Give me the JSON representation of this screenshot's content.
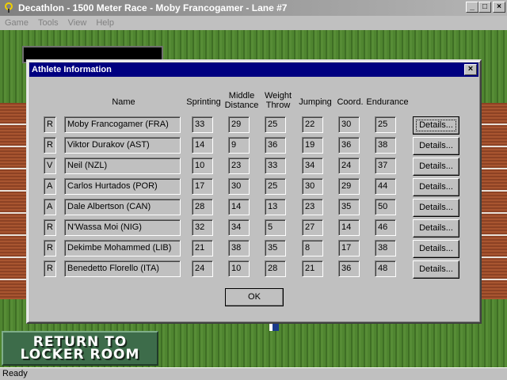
{
  "window": {
    "title": "Decathlon - 1500 Meter Race - Moby Francogamer - Lane #7",
    "icon": "decathlon-app-icon",
    "controls": [
      "minimize",
      "maximize",
      "close"
    ]
  },
  "menu": [
    "Game",
    "Tools",
    "View",
    "Help"
  ],
  "dialog": {
    "title": "Athlete Information",
    "headers": {
      "name": "Name",
      "sprinting": "Sprinting",
      "middle_distance": "Middle Distance",
      "weight_throw": "Weight Throw",
      "jumping": "Jumping",
      "coord": "Coord.",
      "endurance": "Endurance"
    },
    "athletes": [
      {
        "type": "R",
        "name": "Moby Francogamer (FRA)",
        "sprinting": "33",
        "middle_distance": "29",
        "weight_throw": "25",
        "jumping": "22",
        "coord": "30",
        "endurance": "25"
      },
      {
        "type": "R",
        "name": "Viktor Durakov (AST)",
        "sprinting": "14",
        "middle_distance": "9",
        "weight_throw": "36",
        "jumping": "19",
        "coord": "36",
        "endurance": "38"
      },
      {
        "type": "V",
        "name": "Neil  (NZL)",
        "sprinting": "10",
        "middle_distance": "23",
        "weight_throw": "33",
        "jumping": "34",
        "coord": "24",
        "endurance": "37"
      },
      {
        "type": "A",
        "name": "Carlos Hurtados (POR)",
        "sprinting": "17",
        "middle_distance": "30",
        "weight_throw": "25",
        "jumping": "30",
        "coord": "29",
        "endurance": "44"
      },
      {
        "type": "A",
        "name": "Dale Albertson (CAN)",
        "sprinting": "28",
        "middle_distance": "14",
        "weight_throw": "13",
        "jumping": "23",
        "coord": "35",
        "endurance": "50"
      },
      {
        "type": "R",
        "name": "N'Wassa Moi (NIG)",
        "sprinting": "32",
        "middle_distance": "34",
        "weight_throw": "5",
        "jumping": "27",
        "coord": "14",
        "endurance": "46"
      },
      {
        "type": "R",
        "name": "Dekimbe Mohammed (LIB)",
        "sprinting": "21",
        "middle_distance": "38",
        "weight_throw": "35",
        "jumping": "8",
        "coord": "17",
        "endurance": "38"
      },
      {
        "type": "R",
        "name": "Benedetto Florello (ITA)",
        "sprinting": "24",
        "middle_distance": "10",
        "weight_throw": "28",
        "jumping": "21",
        "coord": "36",
        "endurance": "48"
      }
    ],
    "details_label": "Details...",
    "ok_label": "OK"
  },
  "locker_button": {
    "line1": "RETURN TO",
    "line2": "LOCKER ROOM"
  },
  "status": "Ready"
}
